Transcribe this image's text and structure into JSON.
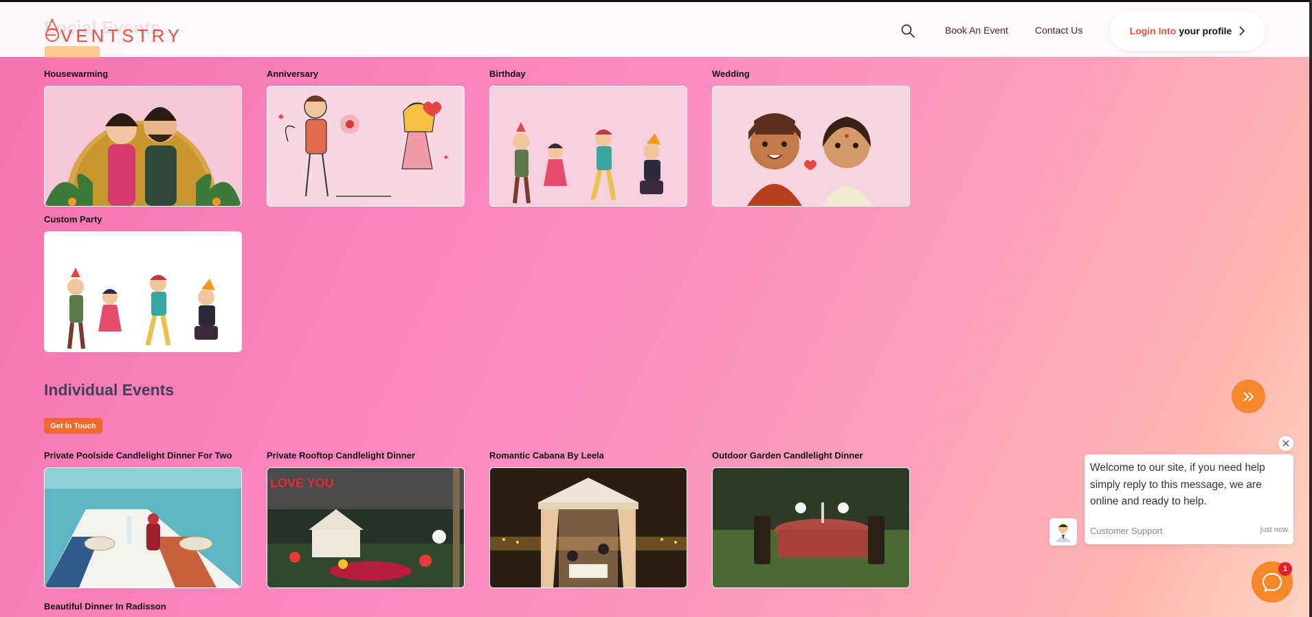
{
  "header": {
    "ghost_section_title": "Social Events",
    "logo_text": "VENTSTRY",
    "nav": {
      "book": "Book An Event",
      "contact": "Contact Us"
    },
    "login": {
      "accent": "Login Into",
      "rest": "your profile"
    }
  },
  "social_events": {
    "cards": [
      {
        "title": "Housewarming"
      },
      {
        "title": "Anniversary"
      },
      {
        "title": "Birthday"
      },
      {
        "title": "Wedding"
      },
      {
        "title": "Custom Party"
      }
    ]
  },
  "individual_events": {
    "title": "Individual Events",
    "cta": "Get In Touch",
    "cards": [
      {
        "title": "Private Poolside Candlelight Dinner For Two"
      },
      {
        "title": "Private Rooftop Candlelight Dinner"
      },
      {
        "title": "Romantic Cabana By Leela"
      },
      {
        "title": "Outdoor Garden Candlelight Dinner"
      },
      {
        "title": "Beautiful Dinner In Radisson"
      }
    ]
  },
  "chat": {
    "message": "Welcome to our site, if you need help simply reply to this message, we are online and ready to help.",
    "from": "Customer Support",
    "time": "just now",
    "badge": "1"
  },
  "colors": {
    "accent": "#f7882a",
    "brand": "#ef4b3e",
    "cta": "#f0692c"
  }
}
